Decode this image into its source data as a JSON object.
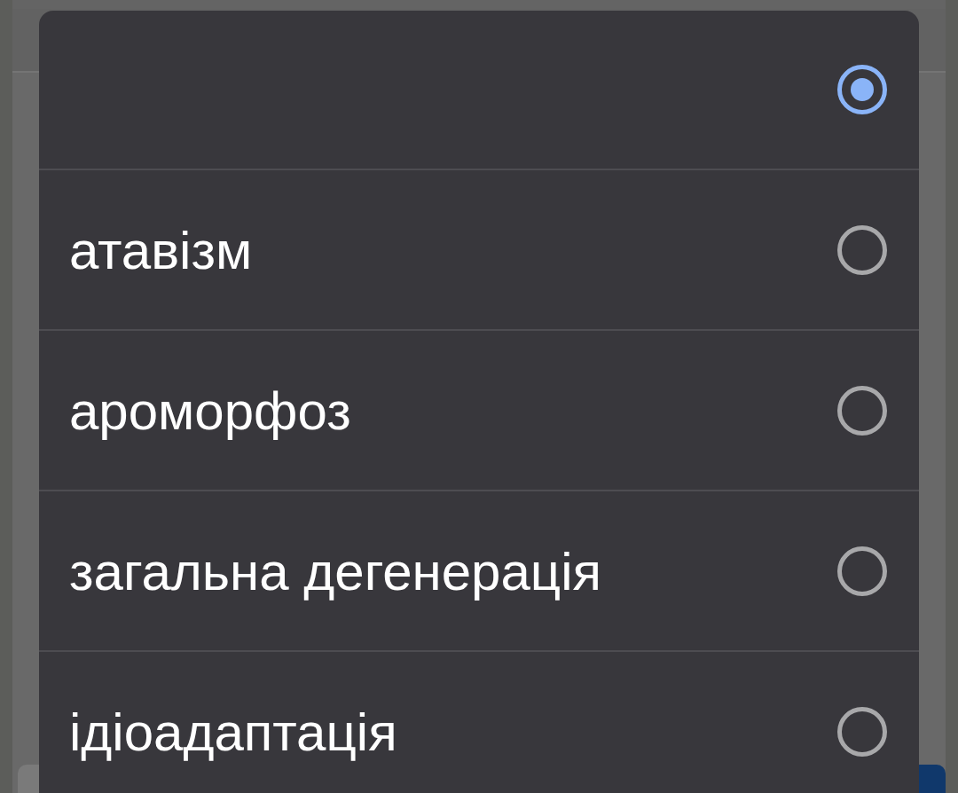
{
  "dialog": {
    "options": [
      {
        "selected": true
      },
      {
        "label": "атавізм",
        "selected": false
      },
      {
        "label": "ароморфоз",
        "selected": false
      },
      {
        "label": "загальна дегенерація",
        "selected": false
      },
      {
        "label": "ідіоадаптація",
        "selected": false
      }
    ]
  }
}
